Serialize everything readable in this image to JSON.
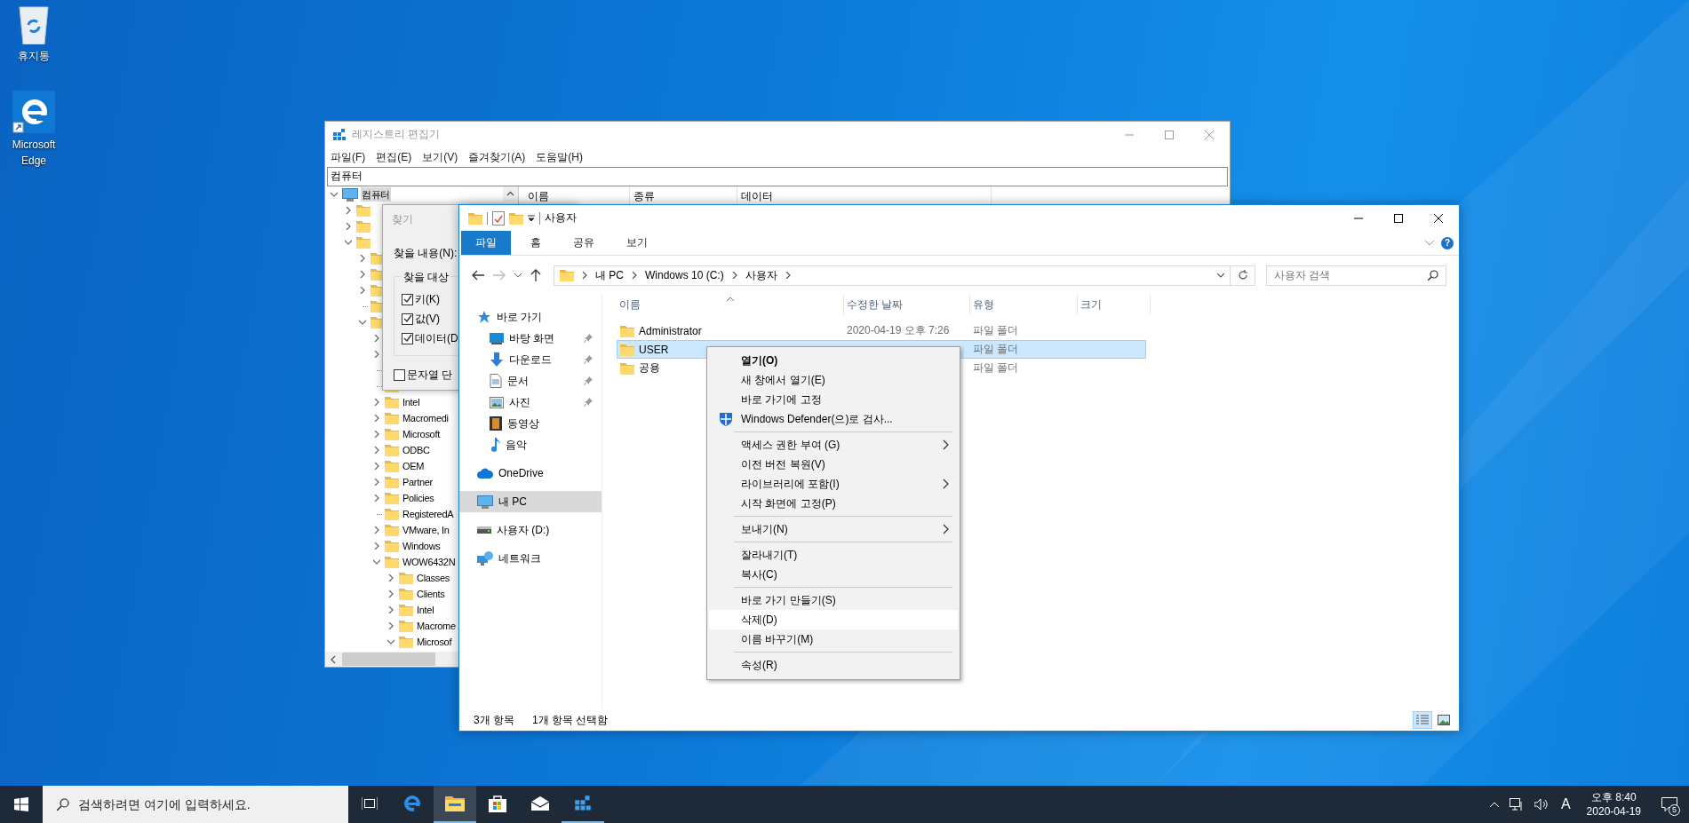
{
  "desktop_icons": [
    {
      "label": "휴지통",
      "kind": "recycle-bin"
    },
    {
      "label": "Microsoft Edge",
      "kind": "browser"
    }
  ],
  "registry_editor": {
    "title": "레지스트리 편집기",
    "menu": [
      "파일(F)",
      "편집(E)",
      "보기(V)",
      "즐겨찾기(A)",
      "도움말(H)"
    ],
    "address": "컴퓨터",
    "columns": [
      "이름",
      "종류",
      "데이터"
    ],
    "tree": [
      {
        "label": "컴퓨터",
        "kind": "computer",
        "expanded": true,
        "selected": true,
        "children": [
          {
            "kind": "branch",
            "expanded": false
          },
          {
            "kind": "branch",
            "expanded": false
          },
          {
            "kind": "branch",
            "expanded": true,
            "children": [
              {
                "kind": "branch",
                "expanded": false
              },
              {
                "kind": "branch",
                "expanded": false
              },
              {
                "kind": "branch",
                "expanded": false
              },
              {
                "kind": "leaf"
              },
              {
                "kind": "branch",
                "expanded": true,
                "children": [
                  {
                    "kind": "branch",
                    "expanded": false
                  },
                  {
                    "kind": "branch",
                    "expanded": false
                  },
                  {
                    "kind": "leaf"
                  },
                  {
                    "kind": "leaf"
                  },
                  {
                    "label": "Intel",
                    "kind": "branch",
                    "expanded": false,
                    "selected": false
                  },
                  {
                    "label": "Macromedi",
                    "kind": "branch",
                    "expanded": false,
                    "selected": false
                  },
                  {
                    "label": "Microsoft",
                    "kind": "branch",
                    "expanded": false,
                    "selected": false
                  },
                  {
                    "label": "ODBC",
                    "kind": "branch",
                    "expanded": false,
                    "selected": false
                  },
                  {
                    "label": "OEM",
                    "kind": "branch",
                    "expanded": false,
                    "selected": false
                  },
                  {
                    "label": "Partner",
                    "kind": "branch",
                    "expanded": false,
                    "selected": false
                  },
                  {
                    "label": "Policies",
                    "kind": "branch",
                    "expanded": false,
                    "selected": false
                  },
                  {
                    "label": "RegisteredA",
                    "kind": "leaf",
                    "selected": false
                  },
                  {
                    "label": "VMware, In",
                    "kind": "branch",
                    "expanded": false,
                    "selected": false
                  },
                  {
                    "label": "Windows",
                    "kind": "branch",
                    "expanded": false,
                    "selected": false
                  },
                  {
                    "label": "WOW6432N",
                    "kind": "branch",
                    "expanded": true,
                    "selected": false,
                    "children": [
                      {
                        "label": "Classes",
                        "kind": "branch",
                        "expanded": false,
                        "selected": false
                      },
                      {
                        "label": "Clients",
                        "kind": "branch",
                        "expanded": false,
                        "selected": false
                      },
                      {
                        "label": "Intel",
                        "kind": "branch",
                        "expanded": false,
                        "selected": false
                      },
                      {
                        "label": "Macrome",
                        "kind": "branch",
                        "expanded": false,
                        "selected": false
                      },
                      {
                        "label": "Microsof",
                        "kind": "branch",
                        "expanded": true,
                        "selected": false
                      }
                    ]
                  }
                ]
              }
            ]
          }
        ]
      }
    ]
  },
  "find_dialog": {
    "title": "찾기",
    "find_label": "찾을 내용(N):",
    "group_label": "찾을 대상",
    "options": [
      {
        "label": "키(K)",
        "checked": true
      },
      {
        "label": "값(V)",
        "checked": true
      },
      {
        "label": "데이터(D",
        "checked": true
      }
    ],
    "whole_string": {
      "label": "문자열 단",
      "checked": false
    }
  },
  "explorer": {
    "title": "사용자",
    "ribbon_tabs": [
      {
        "label": "파일",
        "selected": true
      },
      {
        "label": "홈",
        "selected": false
      },
      {
        "label": "공유",
        "selected": false
      },
      {
        "label": "보기",
        "selected": false
      }
    ],
    "help": "?",
    "breadcrumb": [
      "내 PC",
      "Windows 10 (C:)",
      "사용자"
    ],
    "search": {
      "placeholder": "사용자 검색"
    },
    "nav": [
      {
        "label": "바로 가기",
        "kind": "star",
        "selected": false,
        "children": [
          {
            "label": "바탕 화면",
            "kind": "desktop",
            "pinned": true
          },
          {
            "label": "다운로드",
            "kind": "download",
            "pinned": true
          },
          {
            "label": "문서",
            "kind": "document",
            "pinned": true
          },
          {
            "label": "사진",
            "kind": "picture",
            "pinned": true
          },
          {
            "label": "동영상",
            "kind": "film",
            "pinned": false
          },
          {
            "label": "음악",
            "kind": "music",
            "pinned": false
          }
        ]
      },
      {
        "label": "OneDrive",
        "kind": "cloud",
        "selected": false
      },
      {
        "label": "내 PC",
        "kind": "pc",
        "selected": true
      },
      {
        "label": "사용자 (D:)",
        "kind": "drive",
        "selected": false
      },
      {
        "label": "네트워크",
        "kind": "network",
        "selected": false
      }
    ],
    "columns": [
      "이름",
      "수정한 날짜",
      "유형",
      "크기"
    ],
    "rows": [
      {
        "name": "Administrator",
        "modified": "2020-04-19 오후 7:26",
        "type": "파일 폴더",
        "selected": false
      },
      {
        "name": "USER",
        "type": "파일 폴더",
        "selected": true
      },
      {
        "name": "공용",
        "type": "파일 폴더",
        "selected": false
      }
    ],
    "status": [
      "3개 항목",
      "1개 항목 선택함"
    ],
    "views": [
      {
        "kind": "details",
        "selected": true
      },
      {
        "kind": "large-icons",
        "selected": false
      }
    ]
  },
  "context_menu": [
    {
      "kind": "item",
      "label": "열기(O)",
      "default": true,
      "submenu": false,
      "hovered": false
    },
    {
      "kind": "item",
      "label": "새 창에서 열기(E)",
      "default": false,
      "submenu": false,
      "hovered": false
    },
    {
      "kind": "item",
      "label": "바로 가기에 고정",
      "default": false,
      "submenu": false,
      "hovered": false
    },
    {
      "kind": "shield-item",
      "label": "Windows Defender(으)로 검사...",
      "default": false,
      "submenu": false,
      "hovered": false
    },
    {
      "kind": "separator"
    },
    {
      "kind": "item",
      "label": "액세스 권한 부여 (G)",
      "default": false,
      "submenu": true,
      "hovered": false
    },
    {
      "kind": "item",
      "label": "이전 버전 복원(V)",
      "default": false,
      "submenu": false,
      "hovered": false
    },
    {
      "kind": "item",
      "label": "라이브러리에 포함(I)",
      "default": false,
      "submenu": true,
      "hovered": false
    },
    {
      "kind": "item",
      "label": "시작 화면에 고정(P)",
      "default": false,
      "submenu": false,
      "hovered": false
    },
    {
      "kind": "separator"
    },
    {
      "kind": "item",
      "label": "보내기(N)",
      "default": false,
      "submenu": true,
      "hovered": false
    },
    {
      "kind": "separator"
    },
    {
      "kind": "item",
      "label": "잘라내기(T)",
      "default": false,
      "submenu": false,
      "hovered": false
    },
    {
      "kind": "item",
      "label": "복사(C)",
      "default": false,
      "submenu": false,
      "hovered": false
    },
    {
      "kind": "separator"
    },
    {
      "kind": "item",
      "label": "바로 가기 만들기(S)",
      "default": false,
      "submenu": false,
      "hovered": false
    },
    {
      "kind": "item",
      "label": "삭제(D)",
      "default": false,
      "submenu": false,
      "hovered": true
    },
    {
      "kind": "item",
      "label": "이름 바꾸기(M)",
      "default": false,
      "submenu": false,
      "hovered": false
    },
    {
      "kind": "separator"
    },
    {
      "kind": "item",
      "label": "속성(R)",
      "default": false,
      "submenu": false,
      "hovered": false
    }
  ],
  "taskbar": {
    "search": {
      "placeholder": "검색하려면 여기에 입력하세요."
    },
    "apps": [
      {
        "kind": "task-view",
        "active": false,
        "running": false
      },
      {
        "kind": "browser",
        "active": false,
        "running": false
      },
      {
        "kind": "explorer",
        "active": true,
        "running": true
      },
      {
        "kind": "store",
        "active": false,
        "running": false
      },
      {
        "kind": "mail",
        "active": false,
        "running": false
      },
      {
        "kind": "registry",
        "active": false,
        "running": true
      }
    ],
    "ime": "A",
    "time": "오후 8:40",
    "date": "2020-04-19",
    "notifications": "5"
  }
}
